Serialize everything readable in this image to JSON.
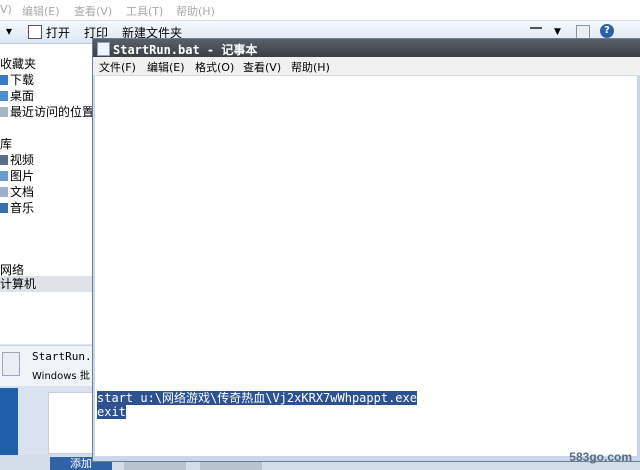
{
  "explorer": {
    "menu": [
      "V)",
      "编辑(E)",
      "查看(V)",
      "工具(T)",
      "帮助(H)"
    ],
    "toolbar": {
      "arrow": "▾",
      "open": "打开",
      "print": "打印",
      "new_folder": "新建文件夹"
    },
    "nav": {
      "favorites": "收藏夹",
      "downloads": "下载",
      "desktop": "桌面",
      "recent": "最近访问的位置",
      "library": "库",
      "videos": "视频",
      "pictures": "图片",
      "documents": "文档",
      "music": "音乐",
      "computer": "计算机",
      "network": "网络"
    },
    "details": {
      "filename": "StartRun.",
      "filetype": "Windows 批"
    },
    "buttons": {
      "add": "添加"
    }
  },
  "notepad": {
    "title": "StartRun.bat - 记事本",
    "menu": [
      "文件(F)",
      "编辑(E)",
      "格式(O)",
      "查看(V)",
      "帮助(H)"
    ],
    "lines": [
      "start u:\\网络游戏\\传奇热血\\Vj2xKRX7wWhpappt.exe",
      "exit"
    ]
  },
  "watermark": "583go.com"
}
